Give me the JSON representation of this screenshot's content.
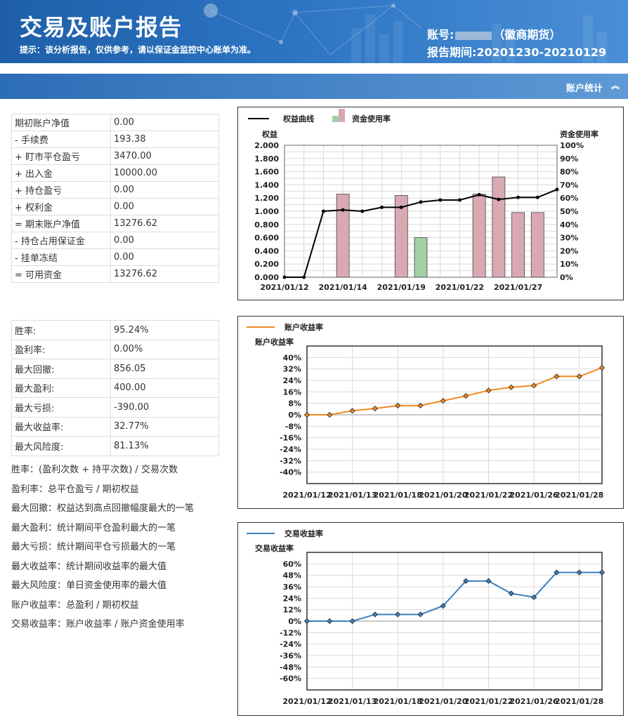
{
  "header": {
    "title": "交易及账户报告",
    "tip": "提示：该分析报告，仅供参考，请以保证金监控中心账单为准。",
    "account_prefix": "账号:",
    "account_suffix": "（徽商期货）",
    "period": "报告期间:20201230-20210129"
  },
  "section": {
    "title": "账户统计",
    "caret": "︽"
  },
  "account_table": [
    {
      "label": "期初账户净值",
      "value": "0.00"
    },
    {
      "label": "- 手续费",
      "value": "193.38"
    },
    {
      "label": "+ 盯市平仓盈亏",
      "value": "3470.00"
    },
    {
      "label": "+ 出入金",
      "value": "10000.00"
    },
    {
      "label": "+ 持仓盈亏",
      "value": "0.00"
    },
    {
      "label": "+ 权利金",
      "value": "0.00"
    },
    {
      "label": "= 期末账户净值",
      "value": "13276.62"
    },
    {
      "label": "- 持仓占用保证金",
      "value": "0.00"
    },
    {
      "label": "- 挂单冻结",
      "value": "0.00"
    },
    {
      "label": "= 可用资金",
      "value": "13276.62"
    }
  ],
  "stats_table": [
    {
      "label": "胜率:",
      "value": "95.24%"
    },
    {
      "label": "盈利率:",
      "value": "0.00%"
    },
    {
      "label": "最大回撤:",
      "value": "856.05"
    },
    {
      "label": "最大盈利:",
      "value": "400.00"
    },
    {
      "label": "最大亏损:",
      "value": "-390.00"
    },
    {
      "label": "最大收益率:",
      "value": "32.77%"
    },
    {
      "label": "最大风险度:",
      "value": "81.13%"
    }
  ],
  "notes": [
    "胜率：(盈利次数 + 持平次数) / 交易次数",
    "盈利率：总平仓盈亏 / 期初权益",
    "最大回撤：权益达到高点回撤幅度最大的一笔",
    "最大盈利：统计期间平仓盈利最大的一笔",
    "最大亏损：统计期间平仓亏损最大的一笔",
    "最大收益率：统计期间收益率的最大值",
    "最大风险度：单日资金使用率的最大值",
    "账户收益率：总盈利 / 期初权益",
    "交易收益率：账户收益率 / 账户资金使用率"
  ],
  "colors": {
    "header_bg": "#2c74c2",
    "equity_line": "#000000",
    "usage_bar": "#d9a9b3",
    "usage_bar_green": "#a3cfa3",
    "account_return_line": "#ef8a1f",
    "trade_return_line": "#3b7fbf",
    "grid": "#d9d9d9"
  },
  "chart_data": [
    {
      "type": "bar",
      "legend": [
        "权益曲线",
        "资金使用率"
      ],
      "ylabel": "权益",
      "y2label": "资金使用率",
      "x_tick_labels": [
        "2021/01/12",
        "2021/01/14",
        "2021/01/19",
        "2021/01/22",
        "2021/01/27"
      ],
      "ylim": [
        0,
        2.0
      ],
      "y_ticks": [
        "0.000",
        "0.200",
        "0.400",
        "0.600",
        "0.800",
        "1.000",
        "1.200",
        "1.400",
        "1.600",
        "1.800",
        "2.000"
      ],
      "y2lim": [
        0,
        100
      ],
      "y2_ticks": [
        "0%",
        "10%",
        "20%",
        "30%",
        "40%",
        "50%",
        "60%",
        "70%",
        "80%",
        "90%",
        "100%"
      ],
      "n_points": 15,
      "series": [
        {
          "name": "权益曲线",
          "kind": "line",
          "values": [
            0.0,
            0.0,
            1.0,
            1.02,
            1.0,
            1.06,
            1.06,
            1.14,
            1.17,
            1.17,
            1.25,
            1.18,
            1.21,
            1.21,
            1.33
          ]
        },
        {
          "name": "资金使用率",
          "kind": "bar",
          "values": [
            null,
            null,
            null,
            63,
            null,
            null,
            62,
            30,
            null,
            null,
            63,
            76,
            49,
            49,
            null
          ],
          "highlight_index": 7
        }
      ]
    },
    {
      "type": "line",
      "legend": [
        "账户收益率"
      ],
      "ylabel": "账户收益率",
      "x_tick_labels": [
        "2021/01/12",
        "2021/01/13",
        "2021/01/18",
        "2021/01/20",
        "2021/01/22",
        "2021/01/26",
        "2021/01/28"
      ],
      "ylim": [
        -48,
        48
      ],
      "y_ticks": [
        "40%",
        "32%",
        "24%",
        "16%",
        "8%",
        "0%",
        "-8%",
        "-16%",
        "-24%",
        "-32%",
        "-40%"
      ],
      "series": [
        {
          "name": "账户收益率",
          "values": [
            0,
            0,
            2.8,
            4.4,
            6.4,
            6.4,
            9.8,
            13.2,
            17.0,
            19.2,
            20.4,
            26.8,
            26.8,
            32.8
          ]
        }
      ]
    },
    {
      "type": "line",
      "legend": [
        "交易收益率"
      ],
      "ylabel": "交易收益率",
      "x_tick_labels": [
        "2021/01/12",
        "2021/01/13",
        "2021/01/18",
        "2021/01/20",
        "2021/01/22",
        "2021/01/26",
        "2021/01/28"
      ],
      "ylim": [
        -72,
        72
      ],
      "y_ticks": [
        "60%",
        "48%",
        "36%",
        "24%",
        "12%",
        "0%",
        "-12%",
        "-24%",
        "-36%",
        "-48%",
        "-60%"
      ],
      "series": [
        {
          "name": "交易收益率",
          "values": [
            0,
            0,
            0,
            7,
            7,
            7,
            16,
            42,
            42,
            29,
            25,
            51,
            51,
            51
          ]
        }
      ]
    }
  ]
}
